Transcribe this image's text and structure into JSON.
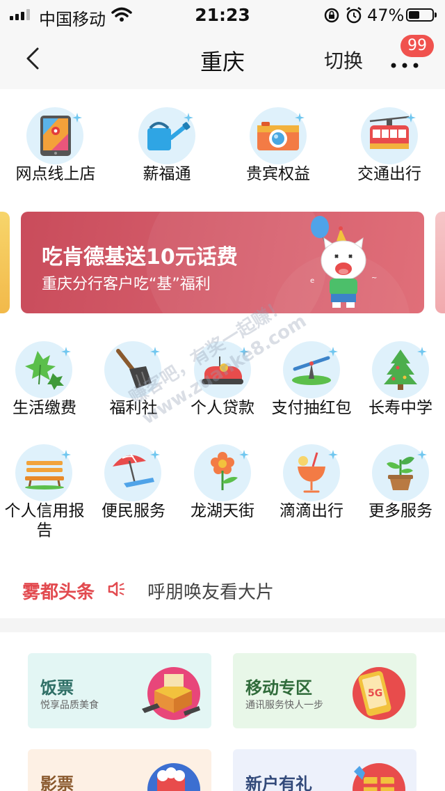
{
  "status": {
    "carrier": "中国移动",
    "time": "21:23",
    "battery": "47%"
  },
  "nav": {
    "title": "重庆",
    "switch": "切换",
    "badge": "99"
  },
  "top_services": [
    {
      "label": "网点线上店",
      "icon": "map-tablet-icon"
    },
    {
      "label": "薪福通",
      "icon": "watering-can-icon"
    },
    {
      "label": "贵宾权益",
      "icon": "camera-icon"
    },
    {
      "label": "交通出行",
      "icon": "cable-car-icon"
    }
  ],
  "banner": {
    "title": "吃肯德基送10元话费",
    "subtitle": "重庆分行客户吃“基”福利"
  },
  "services_row1": [
    {
      "label": "生活缴费",
      "icon": "leaf-icon"
    },
    {
      "label": "福利社",
      "icon": "shovel-icon"
    },
    {
      "label": "个人贷款",
      "icon": "bumper-car-icon"
    },
    {
      "label": "支付抽红包",
      "icon": "seesaw-icon"
    },
    {
      "label": "长寿中学",
      "icon": "christmas-tree-icon"
    }
  ],
  "services_row2": [
    {
      "label": "个人信用报告",
      "icon": "bench-icon"
    },
    {
      "label": "便民服务",
      "icon": "beach-umbrella-icon"
    },
    {
      "label": "龙湖天街",
      "icon": "flower-icon"
    },
    {
      "label": "滴滴出行",
      "icon": "cocktail-icon"
    },
    {
      "label": "更多服务",
      "icon": "potted-plant-icon"
    }
  ],
  "ticker": {
    "title": "雾都头条",
    "text": "呼朋唤友看大片"
  },
  "watermark": {
    "line1": "赚客吧，有奖一起赚！",
    "line2": "www.zuanke8.com"
  },
  "cards": [
    {
      "title": "饭票",
      "subtitle": "悦享品质美食",
      "bg": "#e3f6f4",
      "color": "#2f6f66"
    },
    {
      "title": "移动专区",
      "subtitle": "通讯服务快人一步",
      "bg": "#e8f7e8",
      "color": "#2f6b3a"
    },
    {
      "title": "影票",
      "subtitle": "",
      "bg": "#fdf0e4",
      "color": "#8a5a2e"
    },
    {
      "title": "新户有礼",
      "subtitle": "",
      "bg": "#edf1fb",
      "color": "#334a7a"
    }
  ],
  "colors": {
    "accent_red": "#e24a4f",
    "badge": "#f0524e",
    "icon_bg": "#dff1fb"
  }
}
